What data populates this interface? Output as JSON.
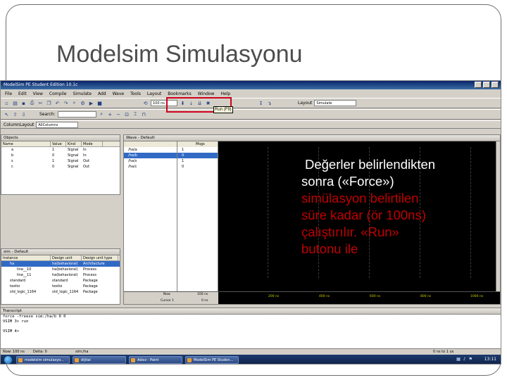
{
  "slide": {
    "title": "Modelsim Simulasyonu"
  },
  "app": {
    "window_title": "ModelSim PE Student Edition 10.1c",
    "menu": [
      "File",
      "Edit",
      "View",
      "Compile",
      "Simulate",
      "Add",
      "Wave",
      "Tools",
      "Layout",
      "Bookmarks",
      "Window",
      "Help"
    ],
    "toolbar": {
      "search_label": "Search:",
      "run_length_value": "100 ns",
      "run_tooltip": "Run (F9)",
      "layout_label": "Layout",
      "layout_value": "Simulate",
      "column_layout_label": "ColumnLayout",
      "column_layout_value": "AllColumns"
    }
  },
  "objects_pane": {
    "title": "Objects",
    "columns": [
      "Name",
      "Value",
      "Kind",
      "Mode"
    ],
    "rows": [
      {
        "name": "a",
        "value": "1",
        "kind": "Signal",
        "mode": "In"
      },
      {
        "name": "b",
        "value": "0",
        "kind": "Signal",
        "mode": "In"
      },
      {
        "name": "s",
        "value": "1",
        "kind": "Signal",
        "mode": "Out"
      },
      {
        "name": "c",
        "value": "0",
        "kind": "Signal",
        "mode": "Out"
      }
    ]
  },
  "sim_pane": {
    "title": "sim - Default",
    "columns": [
      "Instance",
      "Design unit",
      "Design unit type"
    ],
    "rows": [
      {
        "instance": "ha",
        "unit": "ha(behavioral)",
        "type": "Architecture"
      },
      {
        "instance": "line__10",
        "unit": "ha(behavioral)",
        "type": "Process"
      },
      {
        "instance": "line__11",
        "unit": "ha(behavioral)",
        "type": "Process"
      },
      {
        "instance": "standard",
        "unit": "standard",
        "type": "Package"
      },
      {
        "instance": "textio",
        "unit": "textio",
        "type": "Package"
      },
      {
        "instance": "std_logic_1164",
        "unit": "std_logic_1164",
        "type": "Package"
      }
    ]
  },
  "wave_pane": {
    "title": "Wave - Default",
    "msgs_header": "Msgs",
    "signals": [
      {
        "name": "/ha/a",
        "value": "1"
      },
      {
        "name": "/ha/b",
        "value": "0"
      },
      {
        "name": "/ha/s",
        "value": "1"
      },
      {
        "name": "/ha/c",
        "value": "0"
      }
    ],
    "now_label": "Now",
    "now_value": "100 ns",
    "cursor_label": "Cursor 1",
    "cursor_value": "0 ns",
    "ticks": [
      "200 ns",
      "400 ns",
      "600 ns",
      "800 ns",
      "1000 ns"
    ]
  },
  "transcript": {
    "title": "Transcript",
    "lines": [
      "force -freeze sim:/ha/b 0 0",
      "VSIM 3> run",
      "",
      "VSIM 4>"
    ]
  },
  "statusbar": {
    "now_text": "Now: 100 ns",
    "delta_text": "Delta: 0",
    "path_text": "sim:/ha",
    "range_text": "0 ns to 1 us"
  },
  "taskbar": {
    "items": [
      "modelsim simulasyo...",
      "dijital",
      "Adsız - Paint",
      "ModelSim PE Studen..."
    ],
    "clock": "13:11"
  },
  "callout": {
    "bullet": "�",
    "first_line": "Değerler belirlendikten",
    "lines": [
      "sonra («Force»)",
      "simülasyon belirtilen",
      "süre kadar (ör 100ns)",
      "çalıştırılır. «Run»",
      "butonu ile"
    ]
  },
  "colors": {
    "title_text": "#4d4d4d",
    "highlight_box": "#d0021b",
    "callout_red": "#c00000",
    "wave_background": "#000000"
  }
}
